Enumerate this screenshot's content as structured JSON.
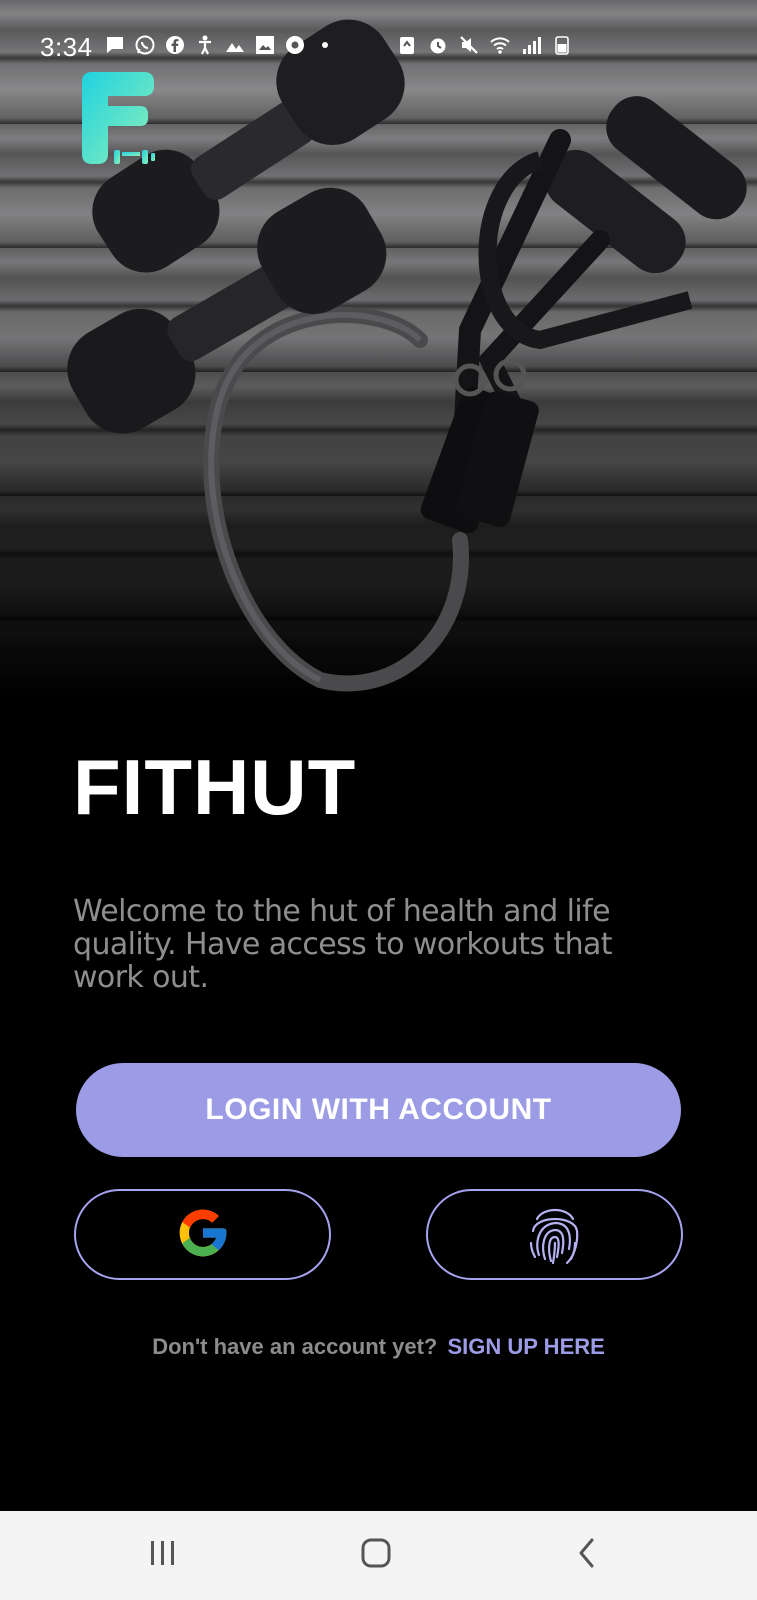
{
  "status_bar": {
    "time": "3:34",
    "left_icons": [
      "message-icon",
      "whatsapp-icon",
      "facebook-icon",
      "accessibility-icon",
      "signal-app-icon",
      "gallery-icon",
      "chrome-icon",
      "dot-icon"
    ],
    "right_icons": [
      "battery-saver-icon",
      "alarm-icon",
      "mute-icon",
      "wifi-icon",
      "cell-signal-icon",
      "battery-icon"
    ]
  },
  "app": {
    "logo_icon": "fithut-logo",
    "title": "FITHUT",
    "welcome_text": "Welcome to the hut of health and life quality. Have access to workouts that work out."
  },
  "actions": {
    "login_label": "LOGIN WITH ACCOUNT",
    "google_icon": "google-icon",
    "fingerprint_icon": "fingerprint-icon"
  },
  "signup": {
    "prompt": "Don't have an account yet?",
    "link": "SIGN UP HERE"
  },
  "nav": {
    "recents_icon": "recents-icon",
    "home_icon": "home-icon",
    "back_icon": "back-icon"
  },
  "colors": {
    "accent": "#9b9be6",
    "outline": "#a7a3ee",
    "background": "#000000",
    "muted_text": "#8e8e8e",
    "logo_gradient_start": "#1fd2e0",
    "logo_gradient_end": "#8ef0b8"
  }
}
